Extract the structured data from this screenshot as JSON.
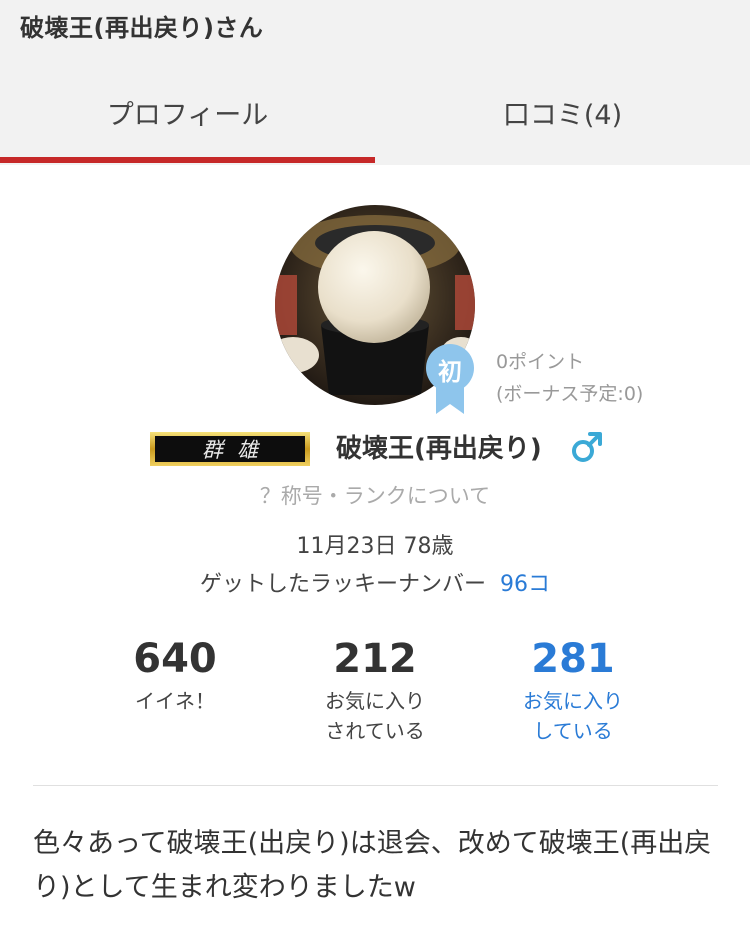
{
  "header": {
    "title": "破壊王(再出戻り)さん"
  },
  "tabs": [
    {
      "label": "プロフィール",
      "active": true
    },
    {
      "label": "口コミ(4)",
      "active": false
    }
  ],
  "profile": {
    "badge": "初",
    "points": "0ポイント",
    "bonus": "(ボーナス予定:0)",
    "rank_plate": "群雄",
    "username": "破壊王(再出戻り)",
    "gender_icon": "male-icon",
    "title_help": "？称号・ランクについて",
    "birthday": "11月23日 78歳",
    "lucky_label": "ゲットしたラッキーナンバー",
    "lucky_value": "96コ"
  },
  "stats": [
    {
      "value": "640",
      "label_line1": "イイネ！",
      "label_line2": ""
    },
    {
      "value": "212",
      "label_line1": "お気に入り",
      "label_line2": "されている"
    },
    {
      "value": "281",
      "label_line1": "お気に入り",
      "label_line2": "している"
    }
  ],
  "bio": "色々あって破壊王(出戻り)は退会、改めて破壊王(再出戻り)として生まれ変わりましたw",
  "colors": {
    "accent_red": "#c62828",
    "link_blue": "#2a7bd6",
    "badge_blue": "#8ec5ec",
    "gender_blue": "#3ba9d6"
  }
}
